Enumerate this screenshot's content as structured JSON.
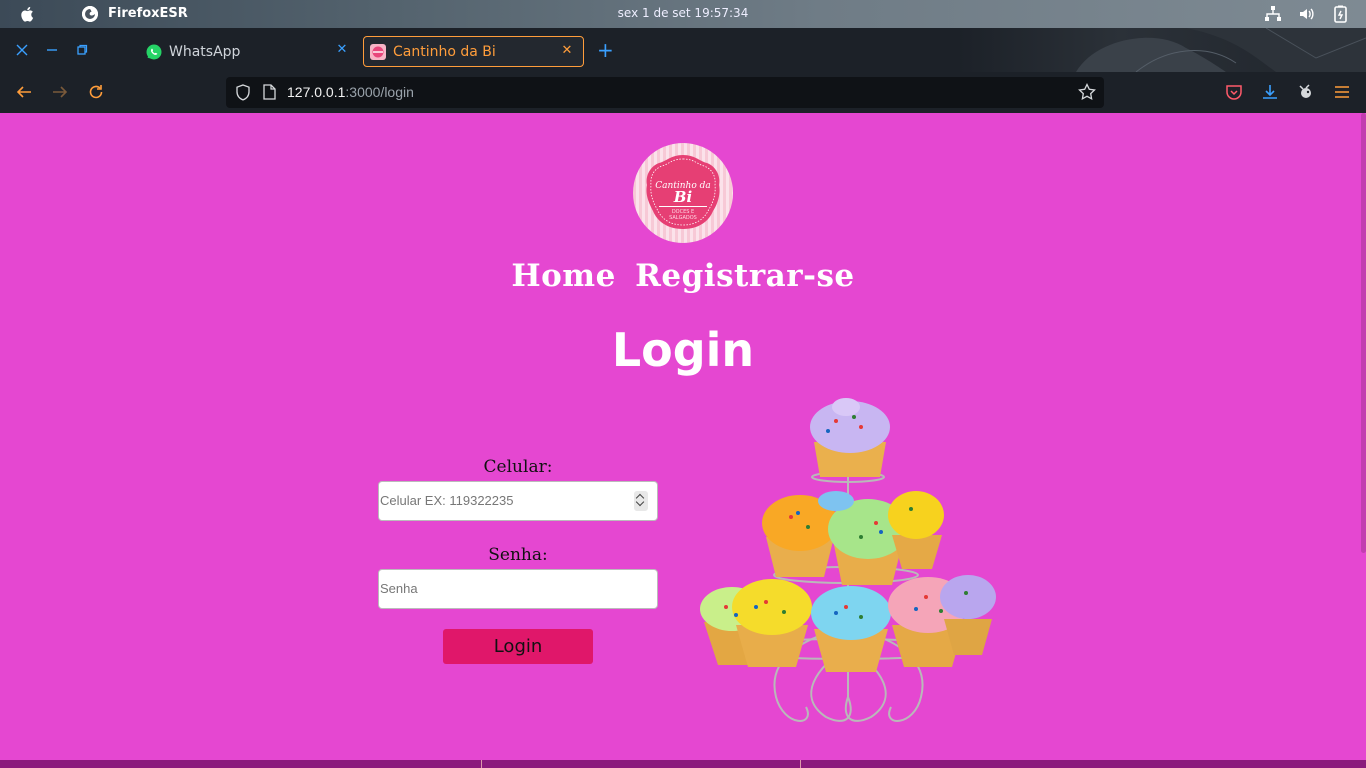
{
  "os_bar": {
    "app_name": "FirefoxESR",
    "clock": "sex 1 de set  19:57:34",
    "icons": [
      "apple-icon",
      "firefox-icon",
      "network-icon",
      "volume-icon",
      "battery-icon"
    ]
  },
  "browser": {
    "tabs": [
      {
        "label": "WhatsApp",
        "icon": "whatsapp-icon"
      },
      {
        "label": "Cantinho da Bi",
        "icon": "site-favicon",
        "active": true
      }
    ],
    "url_host": "127.0.0.1",
    "url_path": ":3000/login",
    "accent_color": "#ff9d3b",
    "icon_color": "#3aa0ff"
  },
  "page": {
    "background": "#e547d1",
    "logo": {
      "line1": "Cantinho da",
      "line2": "Bi",
      "line3": "DOCES E",
      "line4": "SALGADOS"
    },
    "nav": {
      "home": "Home",
      "register": "Registrar-se"
    },
    "title": "Login",
    "form": {
      "phone_label": "Celular:",
      "phone_placeholder": "Celular EX: 119322235",
      "password_label": "Senha:",
      "password_placeholder": "Senha",
      "submit_label": "Login",
      "button_color": "#e0176a"
    }
  }
}
